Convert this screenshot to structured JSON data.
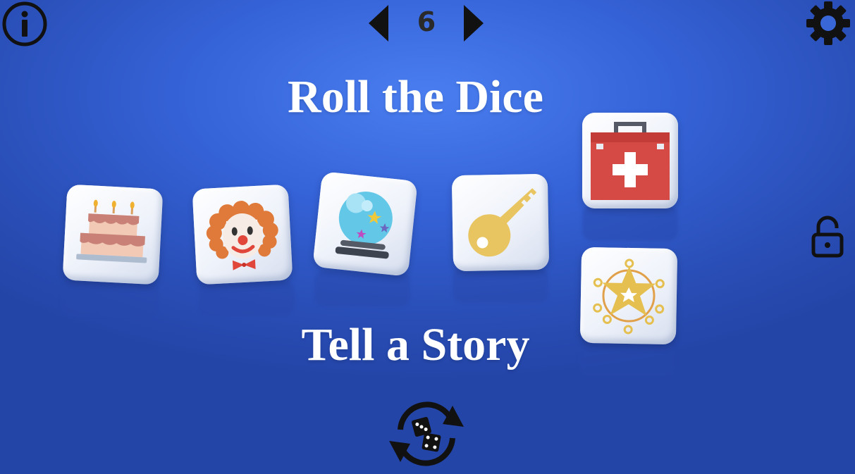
{
  "game": {
    "dice_count": "6",
    "title_top": "Roll the Dice",
    "title_bottom": "Tell a Story"
  },
  "dice": [
    {
      "face": "cake-icon"
    },
    {
      "face": "clown-icon"
    },
    {
      "face": "crystal-ball-icon"
    },
    {
      "face": "key-icon"
    },
    {
      "face": "first-aid-kit-icon"
    },
    {
      "face": "sheriff-badge-icon"
    }
  ],
  "colors": {
    "background": "#3563d8",
    "title_text": "#ffffff",
    "controls": "#111111",
    "die_face": "#f4f7fc"
  }
}
